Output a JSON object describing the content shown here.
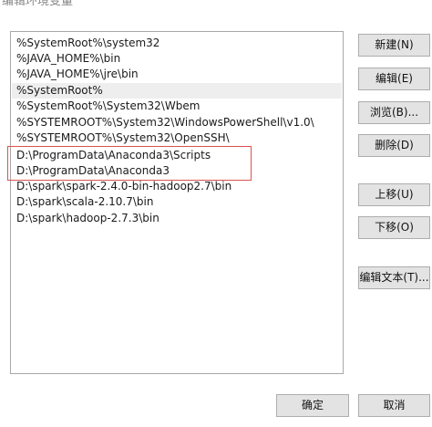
{
  "window": {
    "title": "编辑环境变量"
  },
  "path_list": {
    "items": [
      "%SystemRoot%\\system32",
      "%JAVA_HOME%\\bin",
      "%JAVA_HOME%\\jre\\bin",
      "%SystemRoot%",
      "%SystemRoot%\\System32\\Wbem",
      "%SYSTEMROOT%\\System32\\WindowsPowerShell\\v1.0\\",
      "%SYSTEMROOT%\\System32\\OpenSSH\\",
      "D:\\ProgramData\\Anaconda3\\Scripts",
      "D:\\ProgramData\\Anaconda3",
      "D:\\spark\\spark-2.4.0-bin-hadoop2.7\\bin",
      "D:\\spark\\scala-2.10.7\\bin",
      "D:\\spark\\hadoop-2.7.3\\bin"
    ],
    "selected_index": 3,
    "annotation_color": "#d9534f"
  },
  "buttons": {
    "new": "新建(N)",
    "edit": "编辑(E)",
    "browse": "浏览(B)...",
    "delete": "删除(D)",
    "move_up": "上移(U)",
    "move_down": "下移(O)",
    "edit_text": "编辑文本(T)...",
    "ok": "确定",
    "cancel": "取消"
  }
}
